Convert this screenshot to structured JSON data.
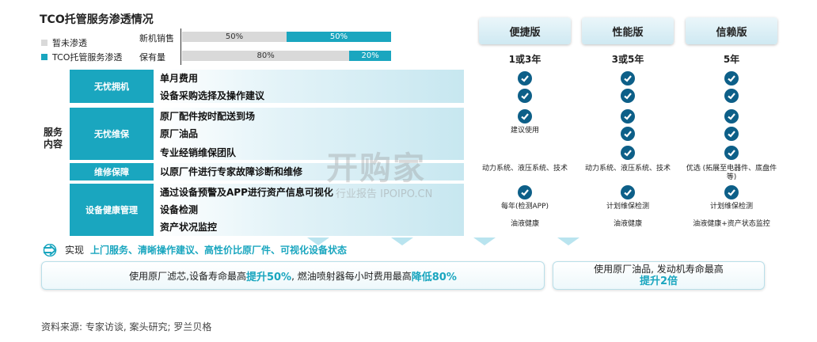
{
  "title": "TCO托管服务渗透情况",
  "legend": {
    "not_penetrated": "暂未渗透",
    "penetrated": "TCO托管服务渗透"
  },
  "colors": {
    "not_penetrated": "#d9d9d9",
    "penetrated": "#1aa6bf",
    "check": "#0d5f88"
  },
  "chart_data": {
    "type": "bar",
    "stacked": true,
    "categories": [
      "新机销售",
      "保有量"
    ],
    "series": [
      {
        "name": "暂未渗透",
        "values": [
          50,
          80
        ]
      },
      {
        "name": "TCO托管服务渗透",
        "values": [
          50,
          20
        ]
      }
    ],
    "labels": [
      [
        "50%",
        "50%"
      ],
      [
        "80%",
        "20%"
      ]
    ]
  },
  "tiers": [
    {
      "name": "便捷版",
      "term": "1或3年"
    },
    {
      "name": "性能版",
      "term": "3或5年"
    },
    {
      "name": "信赖版",
      "term": "5年"
    }
  ],
  "section_label": "服务内容",
  "categories": [
    "无忧拥机",
    "无忧维保",
    "维修保障",
    "设备健康管理"
  ],
  "rows": [
    {
      "label": "单月费用",
      "cells": [
        "check",
        "check",
        "check"
      ]
    },
    {
      "label": "设备采购选择及操作建议",
      "cells": [
        "check",
        "check",
        "check"
      ]
    },
    {
      "label": "原厂配件按时配送到场",
      "cells": [
        "check",
        "check",
        "check"
      ]
    },
    {
      "label": "原厂油品",
      "cells": [
        "建议使用",
        "check",
        "check"
      ]
    },
    {
      "label": "专业经销维保团队",
      "cells": [
        "",
        "check",
        "check"
      ]
    },
    {
      "label": "以原厂件进行专家故障诊断和维修",
      "cells": [
        "动力系统、液压系统、技术",
        "动力系统、液压系统、技术",
        "优选 (拓展至电器件、底盘件等)"
      ]
    },
    {
      "label": "通过设备预警及APP进行资产信息可视化",
      "cells": [
        "check",
        "check",
        "check"
      ]
    },
    {
      "label": "设备检测",
      "cells": [
        "每年(检测APP)",
        "计划维保检测",
        "计划维保检测"
      ]
    },
    {
      "label": "资产状况监控",
      "cells": [
        "油液健康",
        "油液健康",
        "油液健康+资产状态监控"
      ]
    }
  ],
  "realize": {
    "prefix": "实现",
    "highlight": "上门服务、清晰操作建议、高性价比原厂件、可视化设备状态"
  },
  "box1": {
    "pre": "使用原厂滤芯,设备寿命最高",
    "hl1": "提升50%",
    "mid": ", 燃油喷射器每小时费用最高",
    "hl2": "降低80%"
  },
  "box2": {
    "line1": "使用原厂油品, 发动机寿命最高",
    "hl": "提升2倍"
  },
  "watermark": {
    "main": "开购家",
    "sub": "行业报告 IPOIPO.CN"
  },
  "source": "资料来源: 专家访谈, 案头研究; 罗兰贝格"
}
